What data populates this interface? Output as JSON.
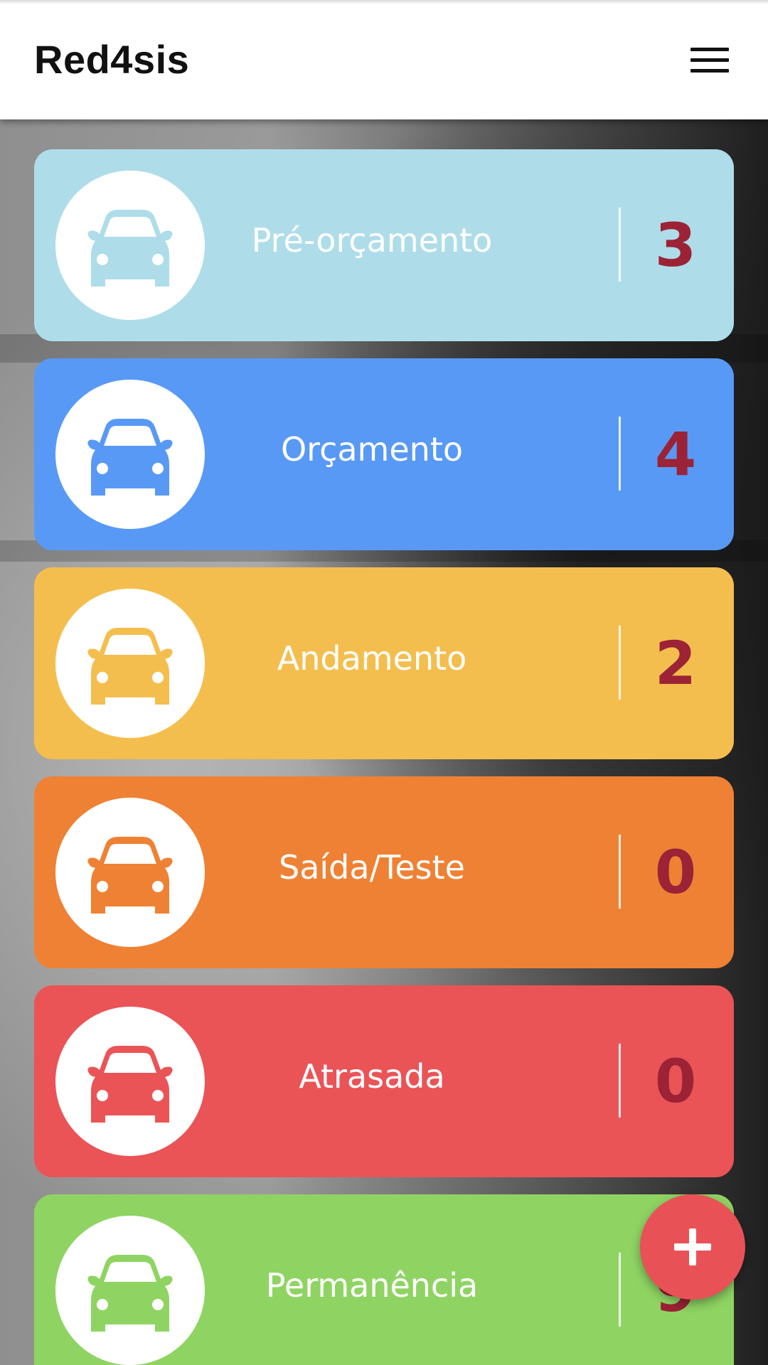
{
  "app": {
    "title": "Red4sis"
  },
  "header": {
    "menu_icon": "hamburger-menu-icon"
  },
  "cards": [
    {
      "label": "Pré-orçamento",
      "count": "3",
      "color": "#aedde9",
      "icon": "car-icon"
    },
    {
      "label": "Orçamento",
      "count": "4",
      "color": "#5899f6",
      "icon": "car-icon"
    },
    {
      "label": "Andamento",
      "count": "2",
      "color": "#f4be4e",
      "icon": "car-icon"
    },
    {
      "label": "Saída/Teste",
      "count": "0",
      "color": "#ef8134",
      "icon": "car-icon"
    },
    {
      "label": "Atrasada",
      "count": "0",
      "color": "#ea5457",
      "icon": "car-icon"
    },
    {
      "label": "Permanência",
      "count": "9",
      "color": "#8fd463",
      "icon": "car-icon"
    }
  ],
  "fab": {
    "icon": "plus-icon",
    "color": "#e85257"
  },
  "colors": {
    "count_text": "#9b2335",
    "header_bg": "#ffffff"
  }
}
